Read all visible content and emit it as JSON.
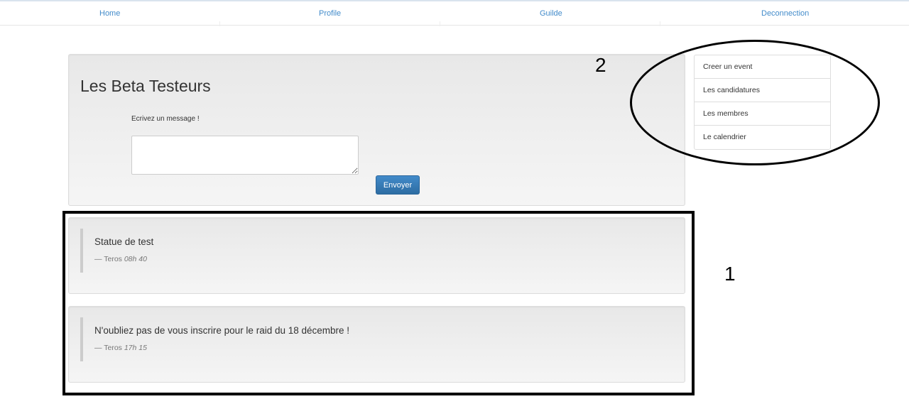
{
  "nav": {
    "items": [
      {
        "label": "Home"
      },
      {
        "label": "Profile"
      },
      {
        "label": "Guilde"
      },
      {
        "label": "Deconnection"
      }
    ]
  },
  "compose": {
    "title": "Les Beta Testeurs",
    "prompt": "Ecrivez un message !",
    "message_value": "",
    "send_label": "Envoyer"
  },
  "side_menu": {
    "items": [
      {
        "label": "Creer un event"
      },
      {
        "label": "Les candidatures"
      },
      {
        "label": "Les membres"
      },
      {
        "label": "Le calendrier"
      }
    ]
  },
  "statuses": [
    {
      "text": "Statue de test",
      "dash": "—",
      "author": "Teros",
      "time": "08h 40"
    },
    {
      "text": "N'oubliez pas de vous inscrire pour le raid du 18 décembre !",
      "dash": "—",
      "author": "Teros",
      "time": "17h 15"
    }
  ],
  "annotations": {
    "label_1": "1",
    "label_2": "2"
  },
  "colors": {
    "link": "#428bca",
    "button": "#428bca"
  }
}
